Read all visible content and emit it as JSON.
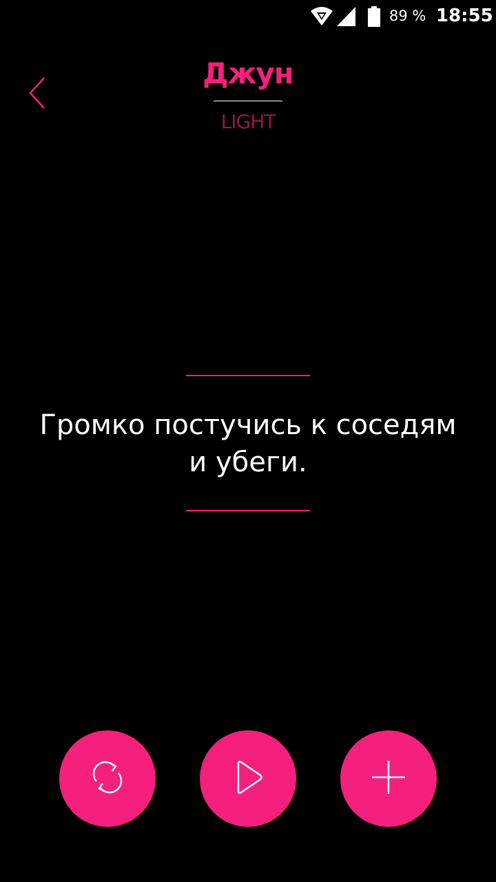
{
  "status_bar": {
    "battery": "89 %",
    "time": "18:55"
  },
  "header": {
    "title": "Джун",
    "subtitle": "LIGHT"
  },
  "task": {
    "text": "Громко постучись к соседям\nи убеги."
  },
  "actions": {
    "refresh_icon": "refresh-icon",
    "play_icon": "play-icon",
    "add_icon": "plus-icon"
  },
  "colors": {
    "accent": "#f51f7d",
    "subtitle": "#8e1a4c",
    "background": "#000000"
  }
}
